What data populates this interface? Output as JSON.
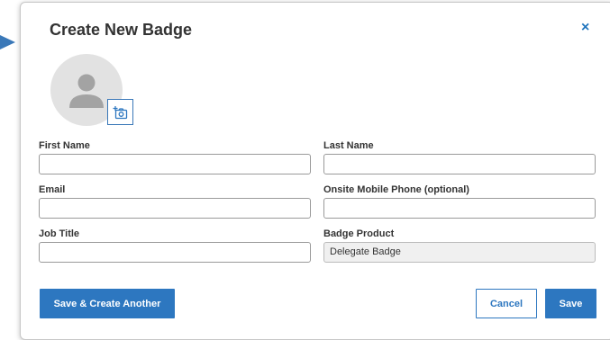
{
  "modal": {
    "title": "Create New Badge",
    "close_symbol": "×"
  },
  "avatar": {
    "icon": "user-placeholder-icon",
    "upload_icon": "add-photo-icon"
  },
  "form": {
    "first_name": {
      "label": "First Name",
      "value": "",
      "placeholder": ""
    },
    "last_name": {
      "label": "Last Name",
      "value": "",
      "placeholder": ""
    },
    "email": {
      "label": "Email",
      "value": "",
      "placeholder": ""
    },
    "onsite_phone": {
      "label": "Onsite Mobile Phone (optional)",
      "value": "",
      "placeholder": ""
    },
    "job_title": {
      "label": "Job Title",
      "value": "",
      "placeholder": ""
    },
    "badge_product": {
      "label": "Badge Product",
      "value": "Delegate Badge"
    }
  },
  "buttons": {
    "save_create_another": "Save & Create Another",
    "cancel": "Cancel",
    "save": "Save"
  },
  "colors": {
    "accent": "#2d77c0",
    "pointer_arrow": "#3a78b8"
  }
}
